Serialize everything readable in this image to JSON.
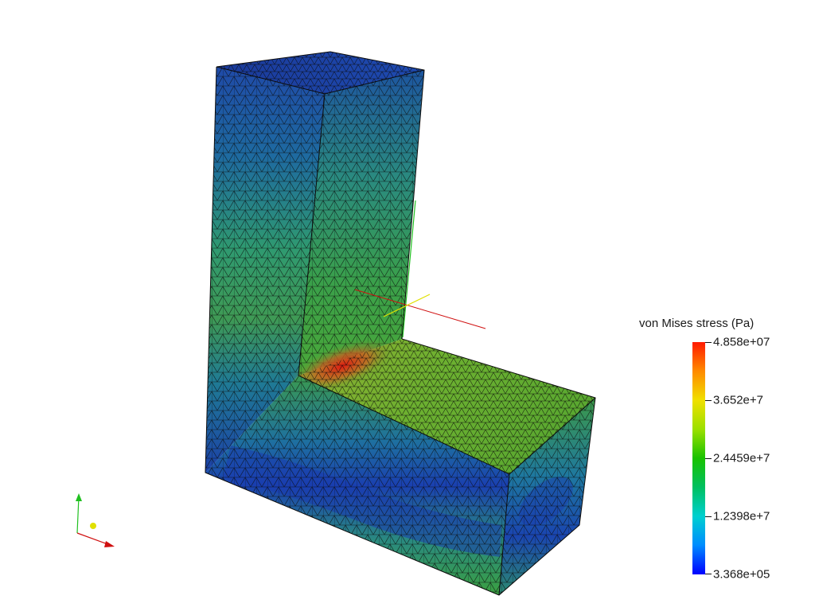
{
  "scalar_bar": {
    "title": "von Mises stress (Pa)",
    "labels": [
      "4.858e+07",
      "3.652e+7",
      "2.4459e+7",
      "1.2398e+7",
      "3.368e+05"
    ],
    "colormap": [
      "#ff1a00",
      "#ff8a00",
      "#f0e000",
      "#9ce000",
      "#19c200",
      "#00c060",
      "#00d0d0",
      "#008cff",
      "#0000ff"
    ]
  },
  "axes_colors": {
    "x": "#d01010",
    "y": "#20c020",
    "z": "#e0e000"
  }
}
